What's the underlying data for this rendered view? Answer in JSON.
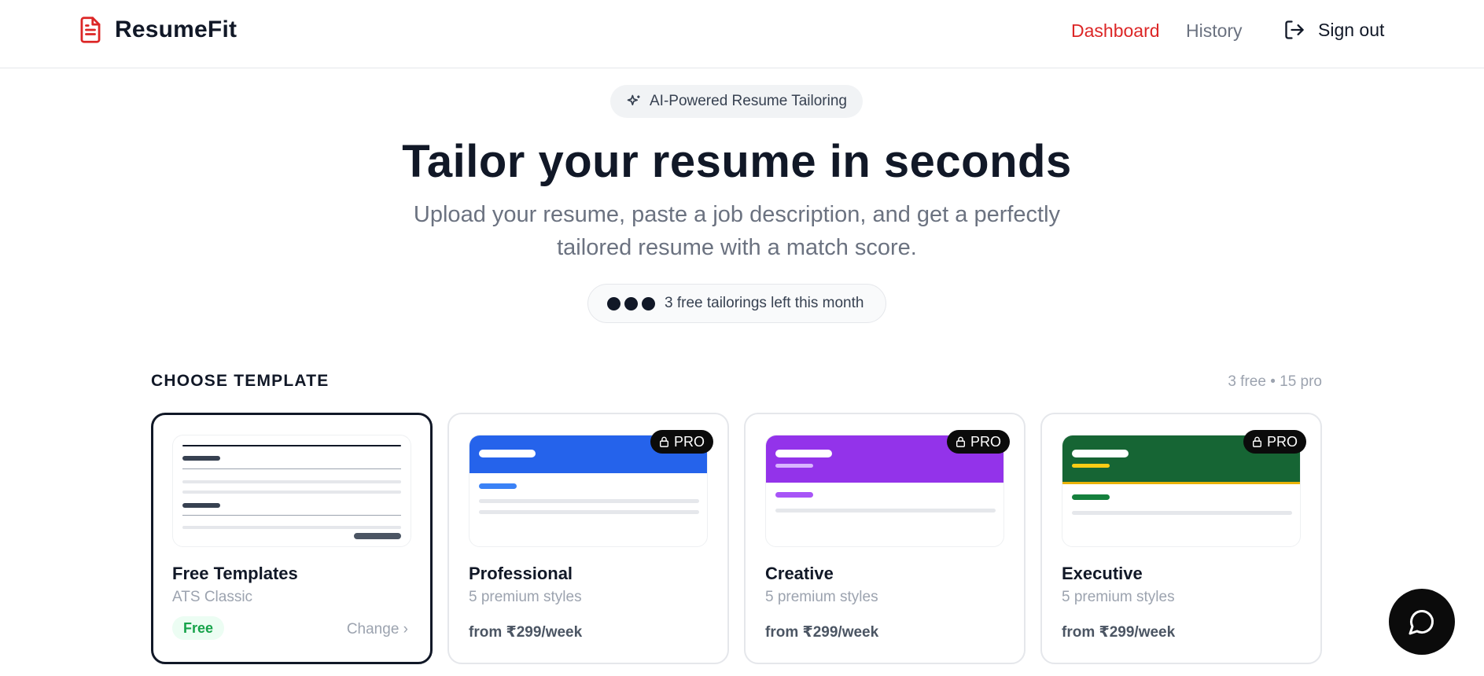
{
  "header": {
    "brand": "ResumeFit",
    "nav": {
      "dashboard": "Dashboard",
      "history": "History",
      "sign_out": "Sign out"
    }
  },
  "hero": {
    "pill": "AI-Powered Resume Tailoring",
    "title": "Tailor your resume in seconds",
    "subtitle": "Upload your resume, paste a job description, and get a perfectly tailored resume with a match score.",
    "quota_text": "3 free tailorings left this month",
    "quota_dots": 3
  },
  "templates": {
    "section_title": "CHOOSE TEMPLATE",
    "count": "3 free • 15 pro",
    "cards": [
      {
        "name": "Free Templates",
        "subtitle": "ATS Classic",
        "badge": "Free",
        "action": "Change ›",
        "selected": true
      },
      {
        "name": "Professional",
        "subtitle": "5 premium styles",
        "price": "from ₹299/week",
        "pro_label": "PRO",
        "accent": "#2563eb"
      },
      {
        "name": "Creative",
        "subtitle": "5 premium styles",
        "price": "from ₹299/week",
        "pro_label": "PRO",
        "accent": "#9333ea"
      },
      {
        "name": "Executive",
        "subtitle": "5 premium styles",
        "price": "from ₹299/week",
        "pro_label": "PRO",
        "accent": "#166534"
      }
    ]
  },
  "colors": {
    "brand_red": "#dc2626",
    "text_dark": "#111827",
    "muted": "#6b7280",
    "free_green": "#16a34a"
  },
  "icons": {
    "logo": "document-icon",
    "sign_out": "logout-icon",
    "pill": "sparkle-icon",
    "pro": "lock-icon",
    "chat": "chat-bubble-icon"
  }
}
